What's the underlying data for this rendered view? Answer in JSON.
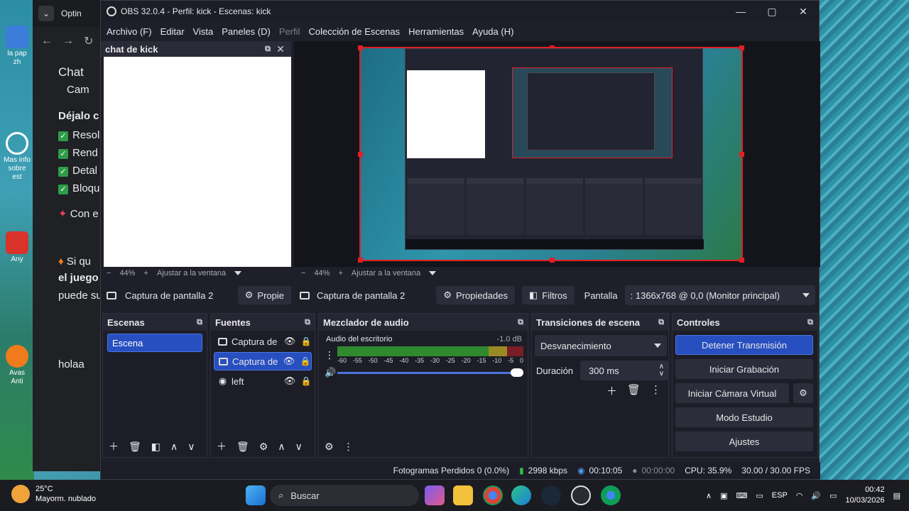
{
  "desktop": {
    "icons": [
      {
        "label": "la pap zh"
      },
      {
        "label": "Mas info sobre est"
      },
      {
        "label": "Any"
      },
      {
        "label": "Avas Anti"
      }
    ]
  },
  "browser": {
    "tab_label": "Optin",
    "lines": [
      "Chat",
      "Cam",
      "Déjalo c",
      "Resol",
      "Rend",
      "Detal",
      "Bloqu",
      "Con e",
      "Si qu",
      "el juego",
      "puede su",
      "holaa"
    ]
  },
  "obs": {
    "title": "OBS 32.0.4 - Perfil: kick - Escenas: kick",
    "menu": [
      "Archivo (F)",
      "Editar",
      "Vista",
      "Paneles (D)",
      "Perfil",
      "Colección de Escenas",
      "Herramientas",
      "Ayuda (H)"
    ],
    "chat_dock_title": "chat de kick",
    "zoom_left": "44%",
    "zoom_left_fit": "Ajustar a la ventana",
    "zoom_main": "44%",
    "zoom_main_fit": "Ajustar a la ventana",
    "chat_toolbar_source": "Captura de pantalla 2",
    "chat_toolbar_props": "Propie",
    "toolbar": {
      "source": "Captura de pantalla 2",
      "properties": "Propiedades",
      "filters": "Filtros",
      "screen_label": "Pantalla",
      "screen_value": ": 1366x768 @ 0,0 (Monitor principal)"
    },
    "scenes": {
      "title": "Escenas",
      "items": [
        "Escena"
      ]
    },
    "sources": {
      "title": "Fuentes",
      "items": [
        {
          "name": "Captura de",
          "selected": false
        },
        {
          "name": "Captura de",
          "selected": true
        },
        {
          "name": "left",
          "selected": false
        }
      ]
    },
    "mixer": {
      "title": "Mezclador de audio",
      "track": "Audio del escritorio",
      "level": "-1.0 dB",
      "ticks": [
        "-60",
        "-55",
        "-50",
        "-45",
        "-40",
        "-35",
        "-30",
        "-25",
        "-20",
        "-15",
        "-10",
        "-5",
        "0"
      ]
    },
    "transitions": {
      "title": "Transiciones de escena",
      "selected": "Desvanecimiento",
      "duration_label": "Duración",
      "duration_value": "300 ms"
    },
    "controls": {
      "title": "Controles",
      "stop_stream": "Detener Transmisión",
      "start_rec": "Iniciar Grabación",
      "virtual_cam": "Iniciar Cámara Virtual",
      "studio": "Modo Estudio",
      "settings": "Ajustes"
    },
    "status": {
      "dropped": "Fotogramas Perdidos 0 (0.0%)",
      "bitrate": "2998 kbps",
      "stream_time": "00:10:05",
      "rec_time": "00:00:00",
      "cpu": "CPU: 35.9%",
      "fps": "30.00 / 30.00 FPS"
    }
  },
  "taskbar": {
    "temp": "25°C",
    "weather": "Mayorm. nublado",
    "search": "Buscar",
    "lang": "ESP",
    "time": "00:42",
    "date": "10/03/2026"
  },
  "colors": {
    "accent": "#284fbf",
    "selection_red": "#e21f26",
    "panel_bg": "#1c1d26"
  }
}
